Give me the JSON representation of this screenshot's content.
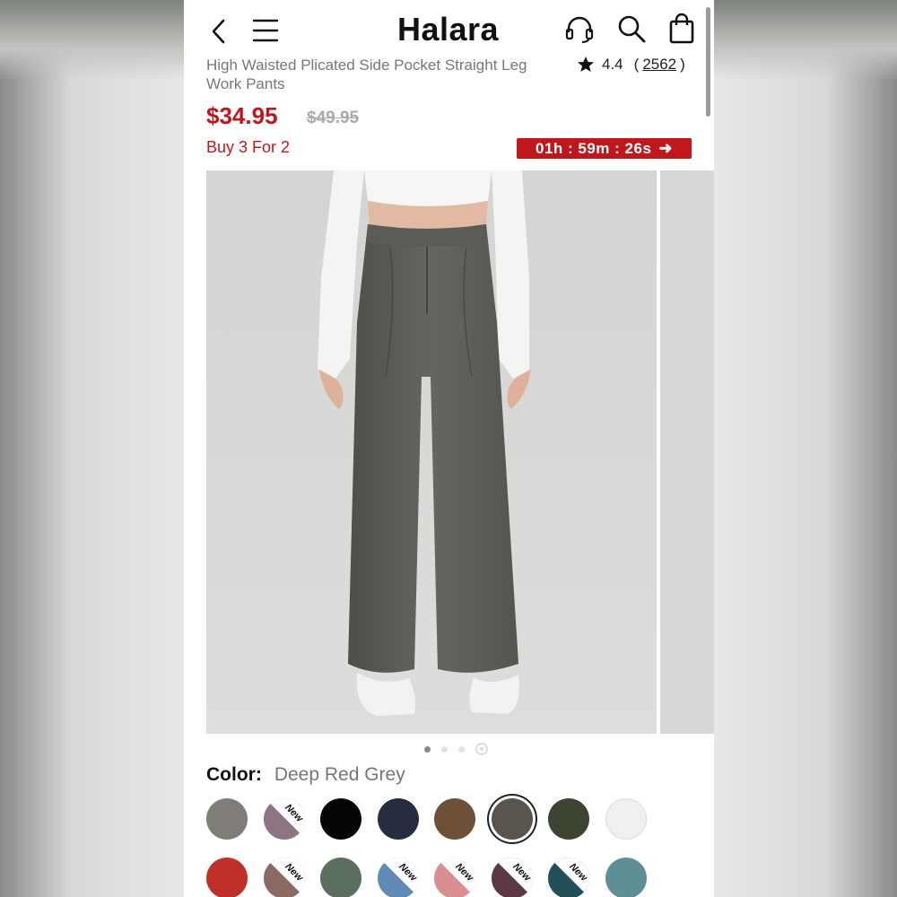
{
  "header": {
    "brand": "Halara",
    "icons": [
      "back-arrow-icon",
      "menu-icon",
      "headset-icon",
      "search-icon",
      "shopping-bag-icon"
    ]
  },
  "product": {
    "title": "High Waisted Plicated Side Pocket Straight Leg Work Pants",
    "rating": "4.4",
    "review_open": "(",
    "review_count": "2562",
    "review_close": ")",
    "price": "$34.95",
    "original_price": "$49.95",
    "promo": "Buy 3 For 2",
    "countdown": "01h : 59m : 26s"
  },
  "gallery": {
    "image_count": 4,
    "active_index": 0
  },
  "color": {
    "label": "Color:",
    "selected": "Deep Red Grey",
    "swatches": [
      {
        "hex": "#807d79",
        "new": false,
        "selected": false
      },
      {
        "hex": "#8e7383",
        "new": true,
        "selected": false
      },
      {
        "hex": "#050505",
        "new": false,
        "selected": false
      },
      {
        "hex": "#272d40",
        "new": false,
        "selected": false
      },
      {
        "hex": "#6e5038",
        "new": false,
        "selected": false
      },
      {
        "hex": "#5a544f",
        "new": false,
        "selected": true
      },
      {
        "hex": "#3d4431",
        "new": false,
        "selected": false
      },
      {
        "hex": "#eff0f2",
        "new": false,
        "selected": false
      },
      {
        "hex": "#c0302a",
        "new": false,
        "selected": false
      },
      {
        "hex": "#8a6a62",
        "new": true,
        "selected": false
      },
      {
        "hex": "#5c6e5e",
        "new": false,
        "selected": false
      },
      {
        "hex": "#5f8bb4",
        "new": true,
        "selected": false
      },
      {
        "hex": "#d98f92",
        "new": true,
        "selected": false
      },
      {
        "hex": "#5b3843",
        "new": true,
        "selected": false
      },
      {
        "hex": "#224f58",
        "new": true,
        "selected": false
      },
      {
        "hex": "#5e8f96",
        "new": false,
        "selected": false
      }
    ],
    "new_label": "New"
  }
}
